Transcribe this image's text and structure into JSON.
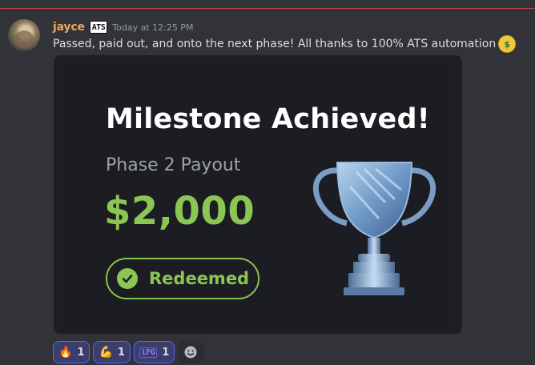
{
  "message": {
    "username": "jayce",
    "badge": "ATS",
    "timestamp": "Today at 12:25 PM",
    "text": "Passed, paid out, and onto the next phase! All thanks to 100% ATS automation",
    "emoji": "money-mouth-face-icon"
  },
  "embed": {
    "title": "Milestone Achieved!",
    "phase_label": "Phase 2 Payout",
    "amount": "$2,000",
    "status": "Redeemed",
    "image": "trophy-icon"
  },
  "reactions": [
    {
      "emoji": "fire-icon",
      "glyph": "🔥",
      "count": "1"
    },
    {
      "emoji": "flexed-biceps-icon",
      "glyph": "💪",
      "count": "1"
    },
    {
      "emoji": "lfg-icon",
      "glyph": "LFG",
      "count": "1"
    }
  ],
  "colors": {
    "background": "#323339",
    "username": "#f0a35a",
    "accent_green": "#8bc653",
    "reaction_border": "#5865f2"
  }
}
